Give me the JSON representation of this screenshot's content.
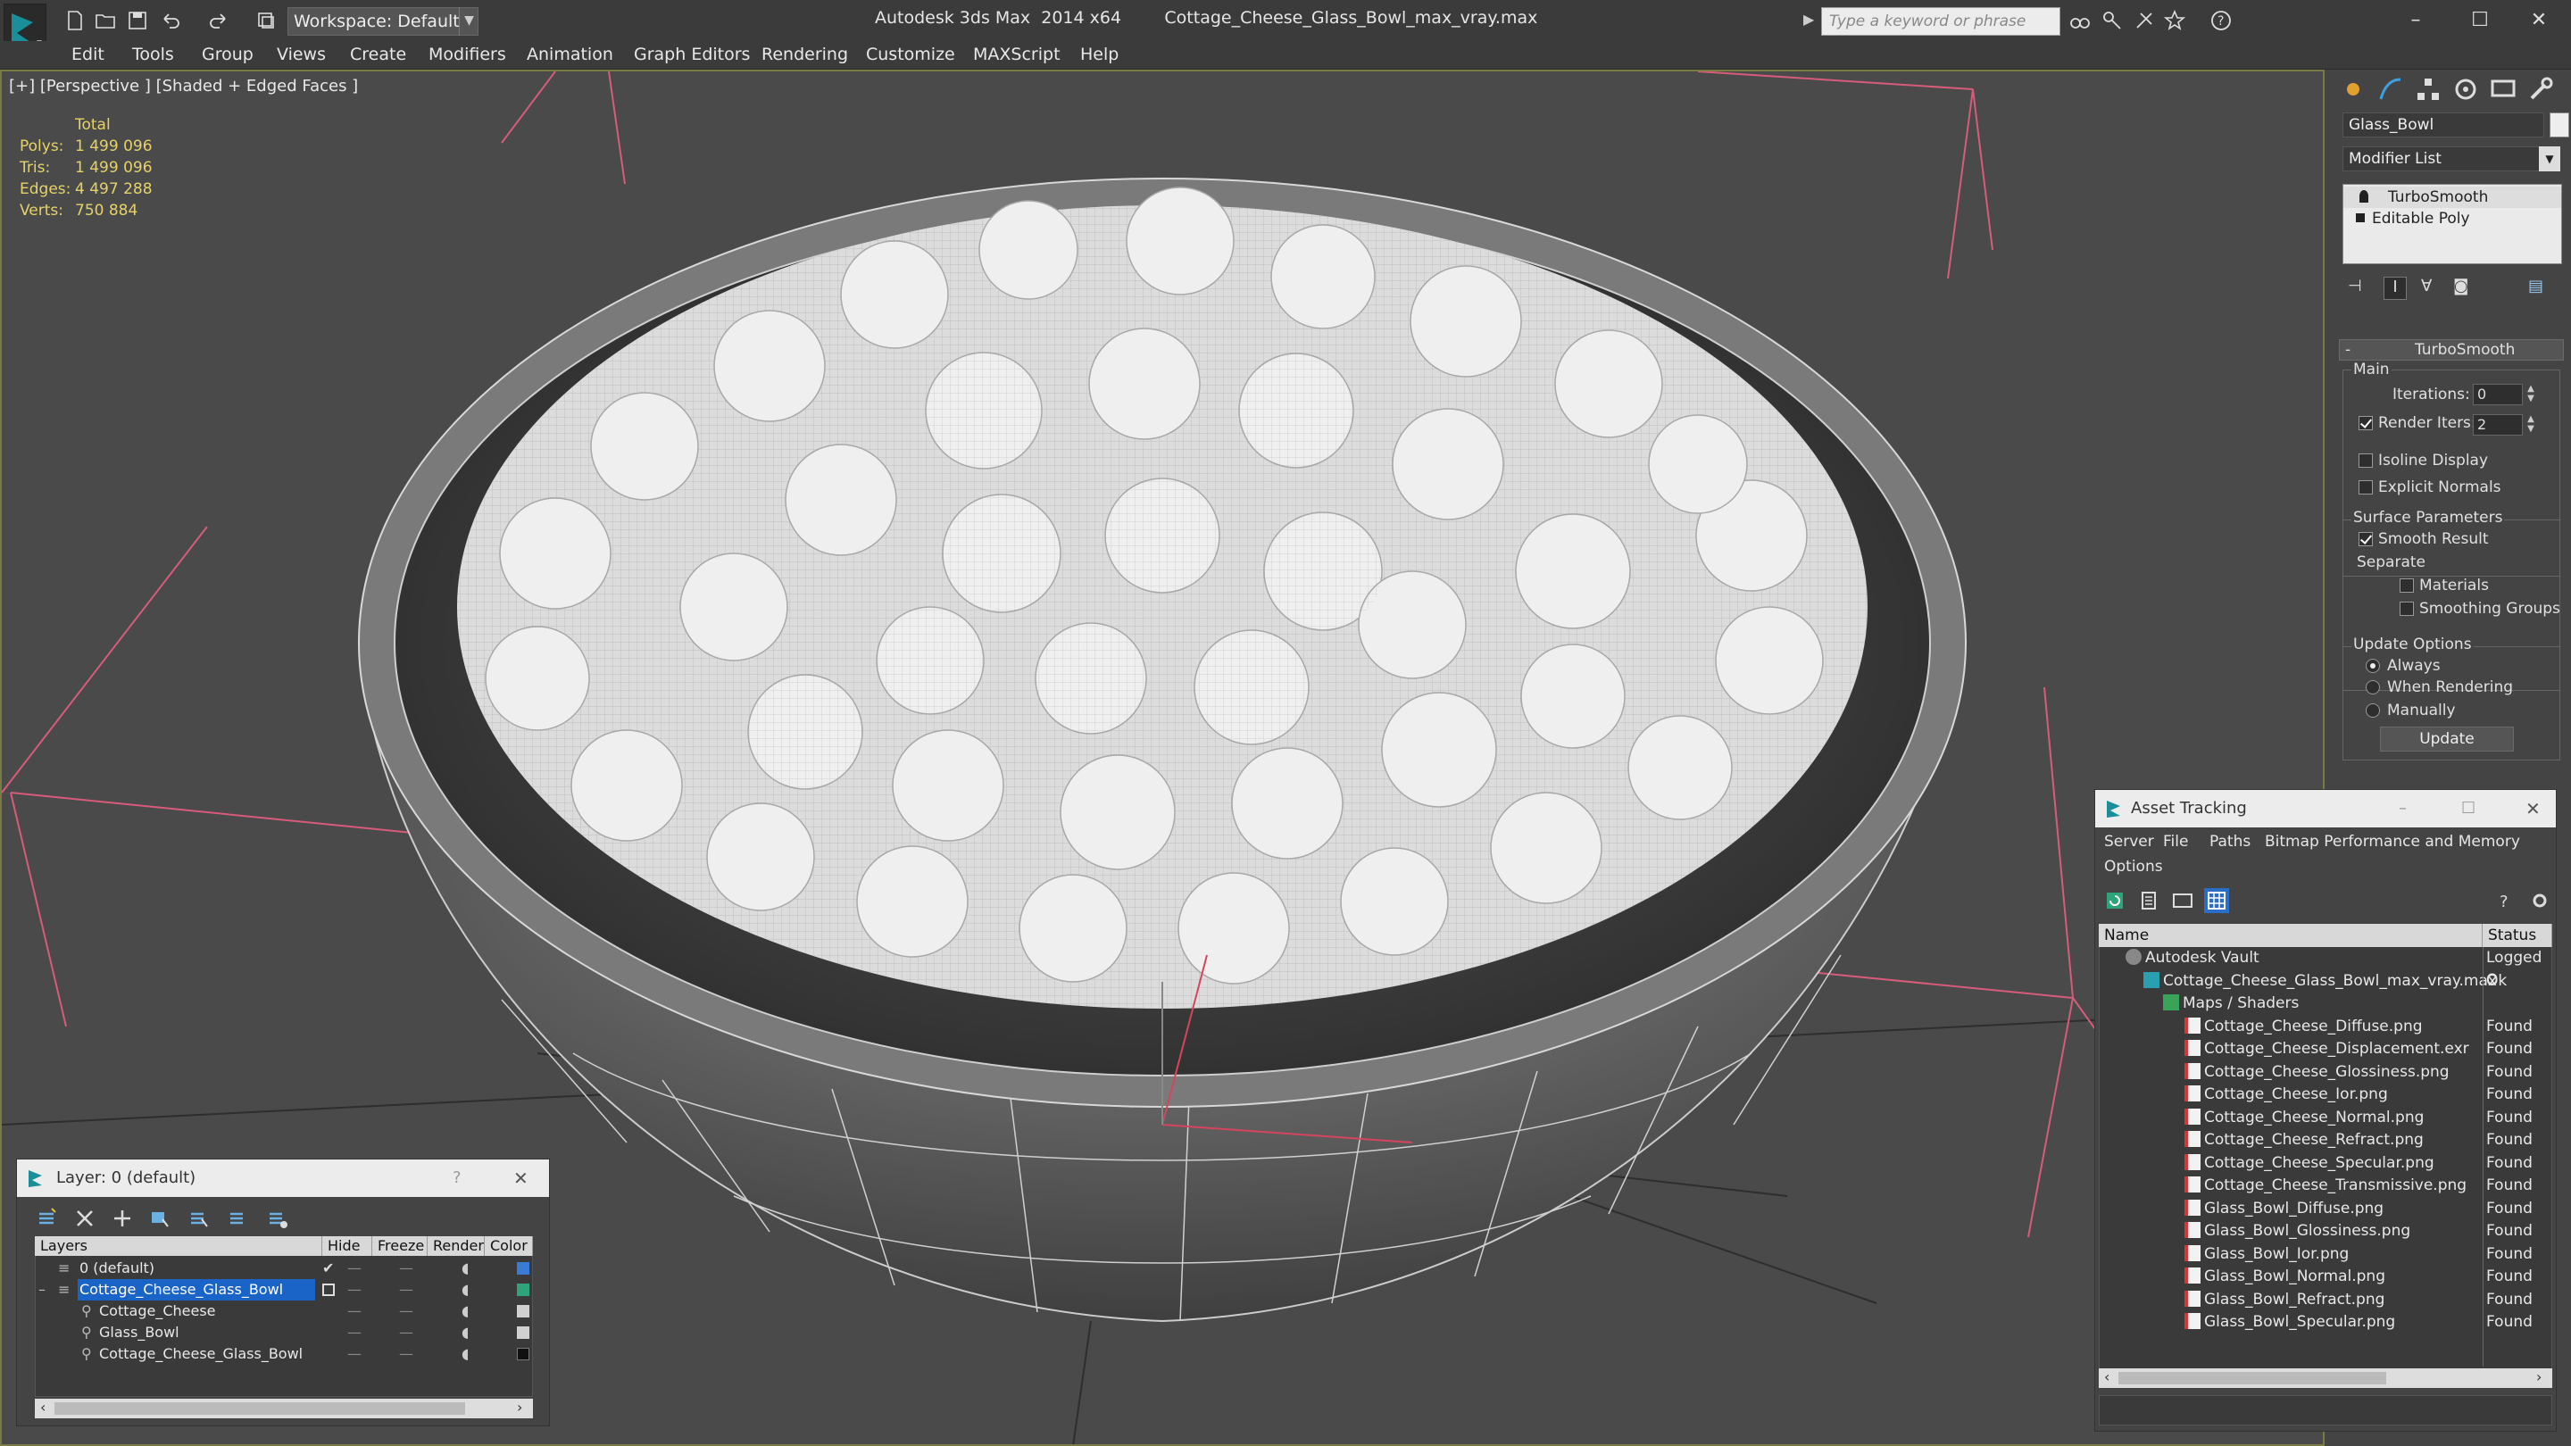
{
  "title_bar": {
    "workspace_label": "Workspace: Default",
    "app_name": "Autodesk 3ds Max  2014 x64",
    "file_name": "Cottage_Cheese_Glass_Bowl_max_vray.max",
    "search_placeholder": "Type a keyword or phrase"
  },
  "menu": [
    "Edit",
    "Tools",
    "Group",
    "Views",
    "Create",
    "Modifiers",
    "Animation",
    "Graph Editors",
    "Rendering",
    "Customize",
    "MAXScript",
    "Help"
  ],
  "viewport": {
    "label": "[+] [Perspective ] [Shaded + Edged Faces ]",
    "stats": {
      "header": "Total",
      "polys_label": "Polys:",
      "polys": "1 499 096",
      "tris_label": "Tris:",
      "tris": "1 499 096",
      "edges_label": "Edges:",
      "edges": "4 497 288",
      "verts_label": "Verts:",
      "verts": "750 884"
    }
  },
  "command_panel": {
    "object_name": "Glass_Bowl",
    "modifier_list": "Modifier List",
    "stack": [
      "TurboSmooth",
      "Editable Poly"
    ],
    "rollout_title": "TurboSmooth",
    "main_group": "Main",
    "iterations_label": "Iterations:",
    "iterations": "0",
    "render_iters_label": "Render Iters:",
    "render_iters": "2",
    "isoline_label": "Isoline Display",
    "explicit_label": "Explicit Normals",
    "surface_group": "Surface Parameters",
    "smooth_result": "Smooth Result",
    "separate": "Separate",
    "materials": "Materials",
    "smoothing_groups": "Smoothing Groups",
    "update_group": "Update Options",
    "always": "Always",
    "when_rendering": "When Rendering",
    "manually": "Manually",
    "update_button": "Update"
  },
  "layer_window": {
    "title": "Layer: 0 (default)",
    "help": "?",
    "columns": [
      "Layers",
      "Hide",
      "Freeze",
      "Render",
      "Color"
    ],
    "rows": [
      {
        "name": "0 (default)",
        "color": "#3a7bd5"
      },
      {
        "name": "Cottage_Cheese_Glass_Bowl",
        "color": "#2fa37a"
      },
      {
        "name": "Cottage_Cheese",
        "color": "#d0d0d0"
      },
      {
        "name": "Glass_Bowl",
        "color": "#d0d0d0"
      },
      {
        "name": "Cottage_Cheese_Glass_Bowl",
        "color": "#111111"
      }
    ]
  },
  "asset_window": {
    "title": "Asset Tracking",
    "menu": [
      "Server",
      "File",
      "Paths",
      "Bitmap Performance and Memory",
      "Options"
    ],
    "columns": [
      "Name",
      "Status"
    ],
    "rows": [
      {
        "name": "Autodesk Vault",
        "status": "Logged O"
      },
      {
        "name": "Cottage_Cheese_Glass_Bowl_max_vray.max",
        "status": "Ok"
      },
      {
        "name": "Maps / Shaders",
        "status": ""
      },
      {
        "name": "Cottage_Cheese_Diffuse.png",
        "status": "Found"
      },
      {
        "name": "Cottage_Cheese_Displacement.exr",
        "status": "Found"
      },
      {
        "name": "Cottage_Cheese_Glossiness.png",
        "status": "Found"
      },
      {
        "name": "Cottage_Cheese_Ior.png",
        "status": "Found"
      },
      {
        "name": "Cottage_Cheese_Normal.png",
        "status": "Found"
      },
      {
        "name": "Cottage_Cheese_Refract.png",
        "status": "Found"
      },
      {
        "name": "Cottage_Cheese_Specular.png",
        "status": "Found"
      },
      {
        "name": "Cottage_Cheese_Transmissive.png",
        "status": "Found"
      },
      {
        "name": "Glass_Bowl_Diffuse.png",
        "status": "Found"
      },
      {
        "name": "Glass_Bowl_Glossiness.png",
        "status": "Found"
      },
      {
        "name": "Glass_Bowl_Ior.png",
        "status": "Found"
      },
      {
        "name": "Glass_Bowl_Normal.png",
        "status": "Found"
      },
      {
        "name": "Glass_Bowl_Refract.png",
        "status": "Found"
      },
      {
        "name": "Glass_Bowl_Specular.png",
        "status": "Found"
      }
    ]
  }
}
